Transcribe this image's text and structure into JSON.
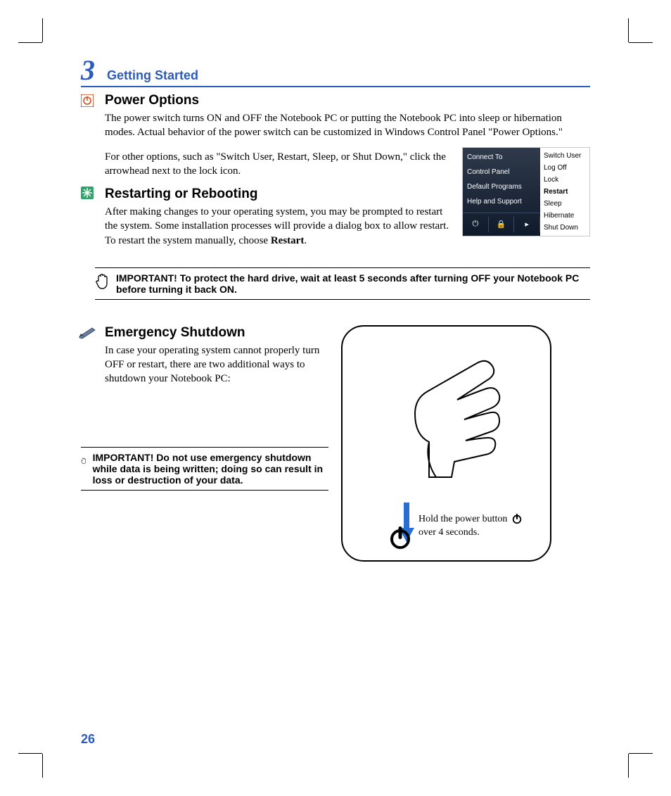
{
  "chapter": {
    "number": "3",
    "title": "Getting Started"
  },
  "power": {
    "heading": "Power Options",
    "p1": "The power switch turns ON and OFF the Notebook PC or putting the Notebook PC into sleep or hibernation modes. Actual behavior of the power switch can be customized in Windows Control Panel \"Power Options.\"",
    "p2": "For other options, such as \"Switch User, Restart, Sleep, or Shut Down,\" click the arrowhead next to the lock icon."
  },
  "restart": {
    "heading": "Restarting or Rebooting",
    "p1_a": "After making changes to your operating system, you may be prompted to restart the system. Some installation processes will provide a dialog box to allow restart. To restart the system manually, choose ",
    "p1_b": "Restart",
    "p1_c": "."
  },
  "start_menu": {
    "left": [
      "Connect To",
      "Control Panel",
      "Default Programs",
      "Help and Support"
    ],
    "right": [
      "Switch User",
      "Log Off",
      "Lock",
      "Restart",
      "Sleep",
      "Hibernate",
      "Shut Down"
    ]
  },
  "important1": "IMPORTANT!  To protect the hard drive, wait at least 5 seconds after turning OFF your Notebook PC before turning it back ON.",
  "emergency": {
    "heading": "Emergency Shutdown",
    "p1": "In case your operating system cannot properly turn OFF or restart, there are two additional ways to shutdown your Notebook PC:",
    "illus_a": "Hold the power button ",
    "illus_b": "over 4 seconds."
  },
  "important2": "IMPORTANT!  Do not use emergency shutdown while data is being written; doing so can result in loss or destruction of your data.",
  "page_number": "26"
}
